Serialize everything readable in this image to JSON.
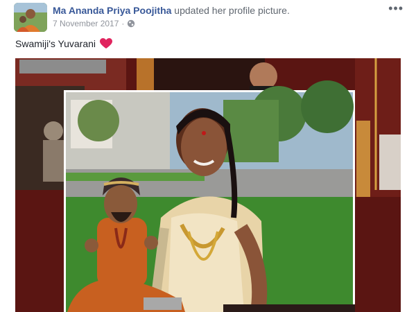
{
  "post": {
    "author": "Ma Ananda Priya Poojitha",
    "action": "updated her profile picture.",
    "date": "7 November 2017",
    "separator": "·",
    "privacy_icon": "globe-icon",
    "more_icon": "more-options-icon",
    "more_label": "•••",
    "caption": "Swamiji's Yuvarani",
    "caption_emoji": "red-heart-icon"
  },
  "colors": {
    "author_link": "#385898",
    "meta_text": "#90949c",
    "heart": "#e0245e"
  }
}
